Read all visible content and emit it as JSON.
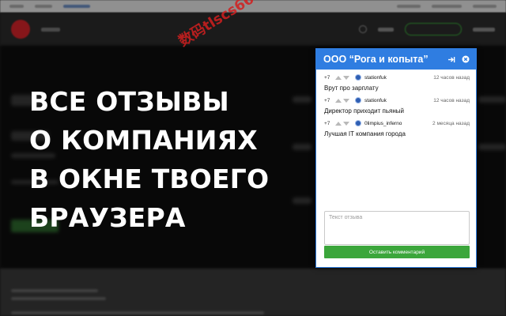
{
  "headline": {
    "lines": [
      "Все отзывы",
      "о компаниях",
      "в окне твоего",
      "браузера"
    ]
  },
  "watermark": "数码tlscs66",
  "popup": {
    "title": "ООО “Рога и копыта”",
    "accent_color": "#2f7de1",
    "reviews": [
      {
        "score": "+7",
        "author": "stationfuk",
        "time": "12 часов назад",
        "text": "Врут про зарплату"
      },
      {
        "score": "+7",
        "author": "stationfuk",
        "time": "12 часов назад",
        "text": "Директор приходит пьяный"
      },
      {
        "score": "+7",
        "author": "0limpius_inferno",
        "time": "2 месяца назад",
        "text": "Лучшая IT компания города"
      }
    ],
    "comment_placeholder": "Текст отзыва",
    "submit_label": "Оставить комментарий",
    "submit_color": "#3ba63b"
  }
}
